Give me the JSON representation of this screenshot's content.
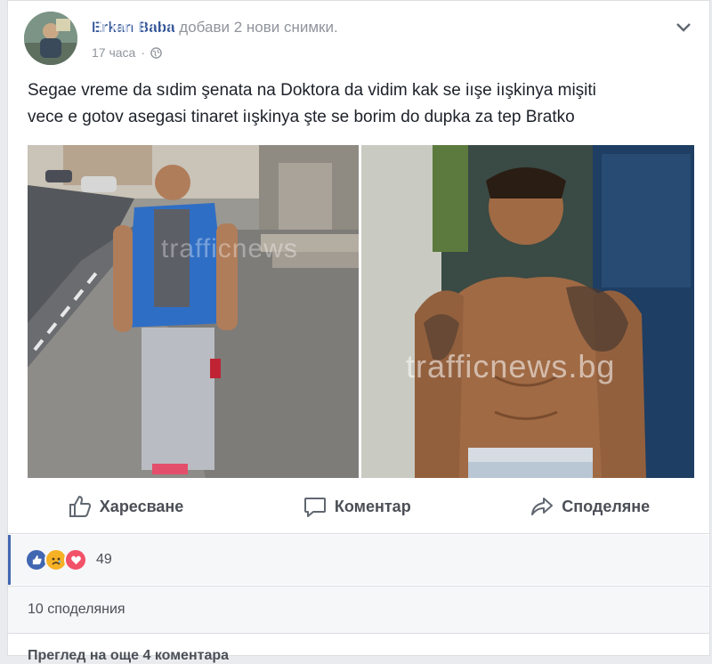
{
  "post": {
    "author": "Erkan Baba",
    "action": "добави 2 нови снимки.",
    "time": "17 часа",
    "separator": "·",
    "text_line1": "Segae vreme da sıdim şenata na Doktora da vidim kak se iışe iışkinya mişiti",
    "text_line2": "vece e gotov asegasi tinaret iışkinya şte se borim do dupka za tep Bratko",
    "watermark_1": "trafficnews",
    "watermark_2": "trafficnews.bg"
  },
  "actions": {
    "like_label": "Харесване",
    "comment_label": "Коментар",
    "share_label": "Споделяне",
    "like_icon": "thumbs-up-icon",
    "comment_icon": "speech-bubble-icon",
    "share_icon": "share-arrow-icon"
  },
  "reactions": {
    "count": "49",
    "types": [
      "like",
      "sad",
      "love"
    ],
    "colors": {
      "like": "#4267b2",
      "sad": "#f7b125",
      "love": "#f25268"
    }
  },
  "shares": {
    "label": "10 споделяния"
  },
  "comments": {
    "previous_label": "Преглед на още 4 коментара"
  }
}
